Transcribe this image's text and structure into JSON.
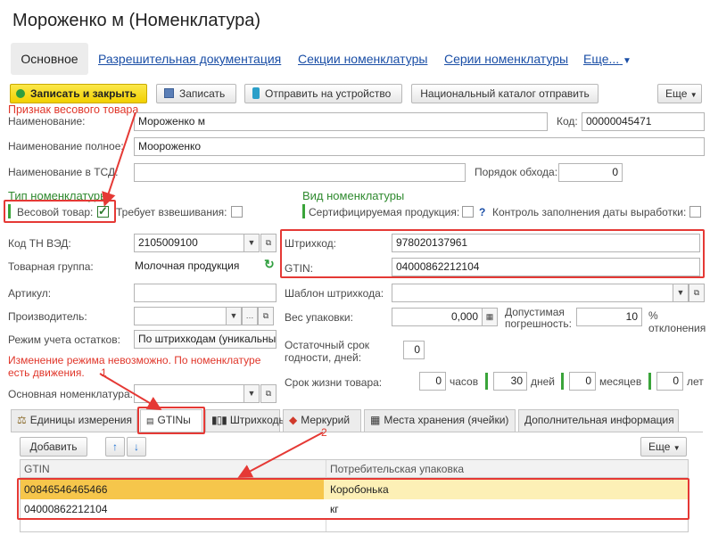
{
  "window_title": "Мороженко м (Номенклатура)",
  "nav": {
    "main": "Основное",
    "links": [
      "Разрешительная документация",
      "Секции номенклатуры",
      "Серии номенклатуры"
    ],
    "more": "Еще..."
  },
  "toolbar": {
    "save_close": "Записать и закрыть",
    "save": "Записать",
    "send_device": "Отправить на устройство",
    "national_catalog": "Национальный каталог отправить",
    "more": "Еще"
  },
  "annotations": {
    "weight_hint": "Признак весового товара",
    "num1": "1",
    "num2": "2"
  },
  "fields": {
    "name_label": "Наименование:",
    "name_value": "Мороженко м",
    "code_label": "Код:",
    "code_value": "00000045471",
    "full_name_label": "Наименование полное:",
    "full_name_value": "Моороженко",
    "tsd_name_label": "Наименование в ТСД:",
    "tsd_name_value": "",
    "order_label": "Порядок обхода:",
    "order_value": "0",
    "type_header": "Тип номенклатуры",
    "kind_header": "Вид номенклатуры",
    "weight_label": "Весовой товар:",
    "weight_checked": true,
    "needs_weighing_label": "Требует взвешивания:",
    "certified_label": "Сертифицируемая продукция:",
    "help_mark": "?",
    "date_control_label": "Контроль заполнения даты выработки:",
    "tnved_label": "Код ТН ВЭД:",
    "tnved_value": "2105009100",
    "group_label": "Товарная группа:",
    "group_value": "Молочная продукция",
    "barcode_label": "Штрихкод:",
    "barcode_value": "978020137961",
    "gtin_label": "GTIN:",
    "gtin_value": "04000862212104",
    "article_label": "Артикул:",
    "article_value": "",
    "barcode_template_label": "Шаблон штрихкода:",
    "barcode_template_value": "",
    "manufacturer_label": "Производитель:",
    "manufacturer_value": "",
    "pack_weight_label": "Вес упаковки:",
    "pack_weight_value": "0,000",
    "tolerance_label": "Допустимая погрешность:",
    "tolerance_value": "10",
    "tolerance_unit": "% отклонения",
    "stock_mode_label": "Режим учета остатков:",
    "stock_mode_value": "По штрихкодам (уникальный",
    "shelf_rest_label": "Остаточный срок годности, дней:",
    "shelf_rest_value": "0",
    "stock_warning": "Изменение режима невозможно. По номенклатуре есть движения.",
    "base_item_label": "Основная номенклатура:",
    "base_item_value": "",
    "shelf_life_label": "Срок жизни товара:",
    "hours_value": "0",
    "hours_label": "часов",
    "days_value": "30",
    "days_label": "дней",
    "months_value": "0",
    "months_label": "месяцев",
    "years_value": "0",
    "years_label": "лет"
  },
  "tabs": [
    "Единицы измерения",
    "GTINы",
    "Штрихкоды",
    "Меркурий",
    "Места хранения (ячейки)",
    "Дополнительная информация"
  ],
  "table": {
    "add_label": "Добавить",
    "more": "Еще",
    "headers": [
      "GTIN",
      "Потребительская упаковка"
    ],
    "rows": [
      [
        "00846546465466",
        "Коробонька"
      ],
      [
        "04000862212104",
        "кг"
      ]
    ]
  },
  "colors": {
    "accent_red": "#e53935",
    "link": "#1a4ea6",
    "green": "#2f8a2f",
    "highlight": "#fdf0b6"
  },
  "icons": [
    "save-icon",
    "phone-icon",
    "refresh-icon",
    "scale-icon",
    "barcode-icon",
    "box-icon",
    "grid-icon",
    "up-arrow-icon",
    "down-arrow-icon",
    "open-icon",
    "dropdown-icon"
  ]
}
